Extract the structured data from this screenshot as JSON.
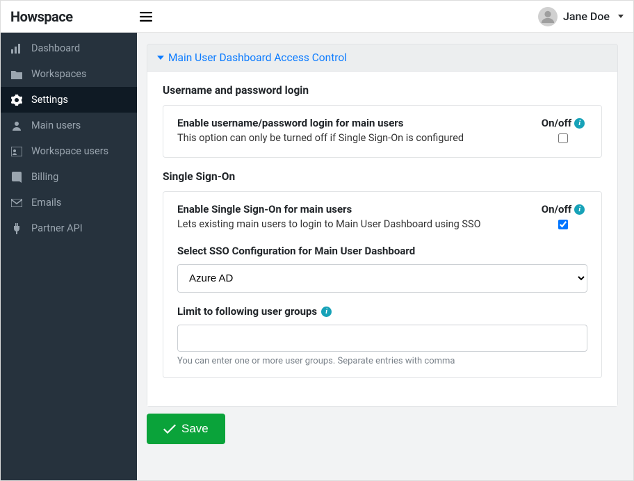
{
  "header": {
    "logo_text": "Howspace",
    "user_name": "Jane Doe"
  },
  "sidebar": {
    "items": [
      {
        "label": "Dashboard",
        "icon": "chart-icon",
        "active": false
      },
      {
        "label": "Workspaces",
        "icon": "folder-icon",
        "active": false
      },
      {
        "label": "Settings",
        "icon": "gear-icon",
        "active": true
      },
      {
        "label": "Main users",
        "icon": "user-icon",
        "active": false
      },
      {
        "label": "Workspace users",
        "icon": "user-card-icon",
        "active": false
      },
      {
        "label": "Billing",
        "icon": "book-icon",
        "active": false
      },
      {
        "label": "Emails",
        "icon": "envelope-icon",
        "active": false
      },
      {
        "label": "Partner API",
        "icon": "plug-icon",
        "active": false
      }
    ]
  },
  "panel": {
    "title": "Main User Dashboard Access Control",
    "section_userpass": {
      "heading": "Username and password login",
      "enable_label": "Enable username/password login for main users",
      "enable_desc": "This option can only be turned off if Single Sign-On is configured",
      "onoff_label": "On/off",
      "checked": false
    },
    "section_sso": {
      "heading": "Single Sign-On",
      "enable_label": "Enable Single Sign-On for main users",
      "enable_desc": "Lets existing main users to login to Main User Dashboard using SSO",
      "onoff_label": "On/off",
      "checked": true,
      "select_label": "Select SSO Configuration for Main User Dashboard",
      "select_value": "Azure AD",
      "select_options": [
        "Azure AD"
      ],
      "groups_label": "Limit to following user groups",
      "groups_value": "",
      "groups_hint": "You can enter one or more user groups. Separate entries with comma"
    },
    "save_label": "Save"
  }
}
